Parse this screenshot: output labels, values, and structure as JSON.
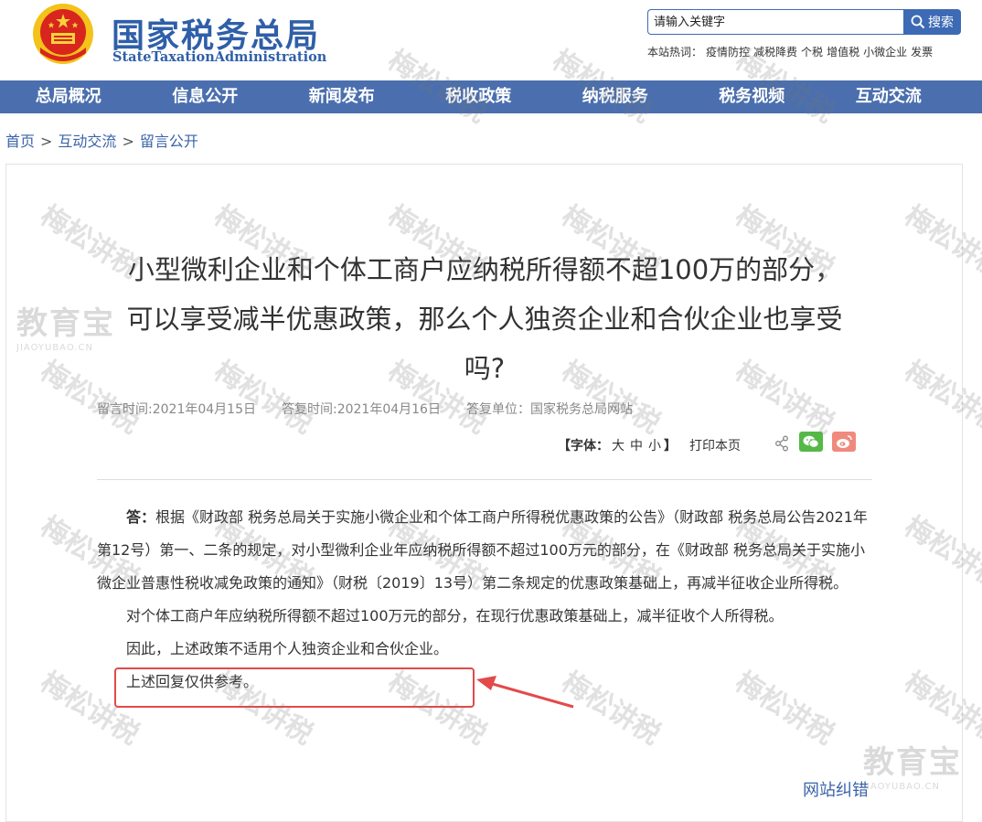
{
  "header": {
    "logo_cn": "国家税务总局",
    "logo_en": "StateTaxationAdministration",
    "search": {
      "placeholder": "请输入关键字",
      "button_label": "搜索"
    },
    "hotwords_label": "本站热词：",
    "hotwords": [
      "疫情防控",
      "减税降费",
      "个税",
      "增值税",
      "小微企业",
      "发票"
    ]
  },
  "nav": [
    "总局概况",
    "信息公开",
    "新闻发布",
    "税收政策",
    "纳税服务",
    "税务视频",
    "互动交流"
  ],
  "breadcrumb": [
    "首页",
    "互动交流",
    "留言公开"
  ],
  "article": {
    "title": "小型微利企业和个体工商户应纳税所得额不超100万的部分，可以享受减半优惠政策，那么个人独资企业和合伙企业也享受吗?",
    "meta": {
      "ask_time": "留言时间:2021年04月15日",
      "reply_time": "答复时间:2021年04月16日",
      "reply_unit": "答复单位：国家税务总局网站"
    },
    "tools": {
      "font_label": "【字体：",
      "font_sizes": [
        "大",
        "中",
        "小"
      ],
      "font_close": "】",
      "print": "打印本页"
    },
    "answer_label": "答：",
    "paragraphs": [
      "根据《财政部 税务总局关于实施小微企业和个体工商户所得税优惠政策的公告》（财政部 税务总局公告2021年第12号）第一、二条的规定，对小型微利企业年应纳税所得额不超过100万元的部分，在《财政部 税务总局关于实施小微企业普惠性税收减免政策的通知》（财税〔2019〕13号）第二条规定的优惠政策基础上，再减半征收企业所得税。",
      "对个体工商户年应纳税所得额不超过100万元的部分，在现行优惠政策基础上，减半征收个人所得税。",
      "因此，上述政策不适用个人独资企业和合伙企业。",
      "上述回复仅供参考。"
    ],
    "report_link": "网站纠错"
  },
  "watermark": {
    "text": "梅松讲税",
    "logo_cn": "教育宝",
    "logo_en": "JIAOYUBAO.CN"
  },
  "colors": {
    "brand_blue": "#2f5fa8",
    "nav_bg": "#4b6fae",
    "highlight_red": "#e34a4a"
  }
}
